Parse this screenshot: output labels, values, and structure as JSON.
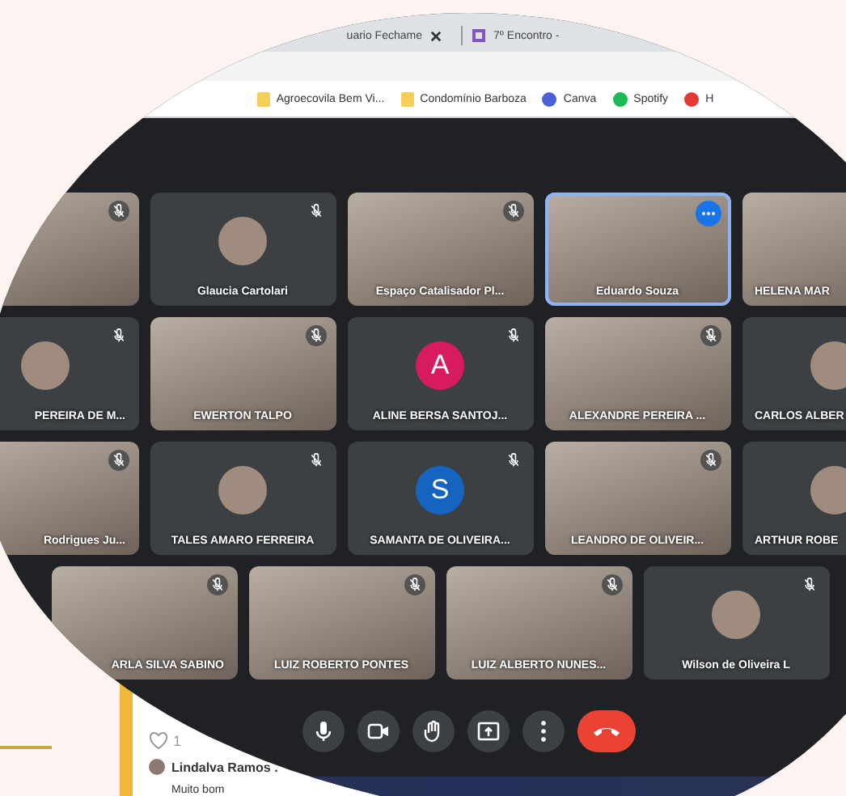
{
  "browser": {
    "tabs": [
      {
        "title": "uario Fechame",
        "selected": false
      },
      {
        "title": "7º Encontro -",
        "selected": true
      }
    ],
    "bookmarks": [
      {
        "label": "Agroecovila Bem Vi...",
        "kind": "folder"
      },
      {
        "label": "Condomínio Barboza",
        "kind": "folder"
      },
      {
        "label": "Canva",
        "kind": "canva"
      },
      {
        "label": "Spotify",
        "kind": "spotify"
      },
      {
        "label": "H",
        "kind": "site"
      }
    ]
  },
  "meeting": {
    "rows": [
      [
        {
          "kind": "video",
          "muted": true,
          "selected": false
        },
        {
          "name": "Glaucia Cartolari",
          "kind": "avatar",
          "muted": true,
          "selected": false
        },
        {
          "name": "Espaço Catalisador Pl...",
          "kind": "video",
          "muted": true,
          "selected": false
        },
        {
          "name": "Eduardo Souza",
          "kind": "video",
          "selected": true
        },
        {
          "name": "HELENA MAR",
          "kind": "video",
          "selected": false
        }
      ],
      [
        {
          "name": "PEREIRA DE M...",
          "kind": "avatar",
          "muted": true,
          "selected": false
        },
        {
          "name": "EWERTON TALPO",
          "kind": "video",
          "muted": true,
          "selected": false
        },
        {
          "name": "ALINE BERSA SANTOJ...",
          "kind": "letter",
          "letter": "A",
          "color": "#d81b60",
          "muted": true,
          "selected": false
        },
        {
          "name": "ALEXANDRE PEREIRA ...",
          "kind": "video",
          "muted": true,
          "selected": false
        },
        {
          "name": "CARLOS ALBER",
          "kind": "avatar",
          "selected": false
        }
      ],
      [
        {
          "name": "Rodrigues Ju...",
          "kind": "video",
          "muted": true,
          "selected": false
        },
        {
          "name": "TALES AMARO FERREIRA",
          "kind": "avatar",
          "muted": true,
          "selected": false
        },
        {
          "name": "SAMANTA DE OLIVEIRA...",
          "kind": "letter",
          "letter": "S",
          "color": "#1565c0",
          "muted": true,
          "selected": false
        },
        {
          "name": "LEANDRO DE OLIVEIR...",
          "kind": "video",
          "muted": true,
          "selected": false
        },
        {
          "name": "ARTHUR ROBE",
          "kind": "avatar",
          "selected": false
        }
      ],
      [
        {
          "name": "ARLA SILVA SABINO",
          "kind": "video",
          "muted": true,
          "selected": false
        },
        {
          "name": "LUIZ ROBERTO PONTES",
          "kind": "video",
          "muted": true,
          "selected": false
        },
        {
          "name": "LUIZ ALBERTO NUNES...",
          "kind": "video",
          "muted": true,
          "selected": false
        },
        {
          "name": "Wilson de Oliveira L",
          "kind": "avatar",
          "muted": true,
          "selected": false
        }
      ]
    ]
  },
  "comment": {
    "likes": "1",
    "author": "Lindalva Ramos .",
    "text": "Muito bom"
  }
}
